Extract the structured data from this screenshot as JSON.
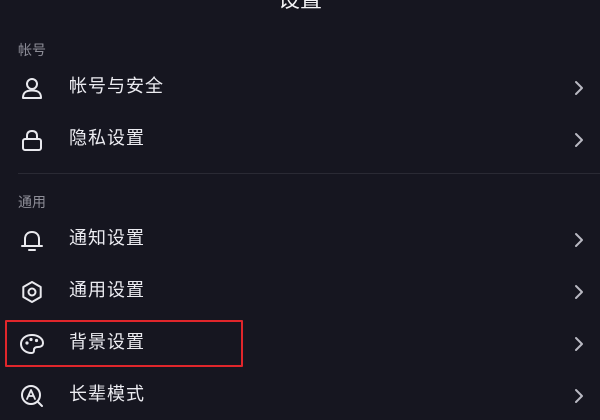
{
  "header": {
    "title": "设置"
  },
  "sections": [
    {
      "label": "帐号",
      "items": [
        {
          "label": "帐号与安全",
          "icon": "person-icon"
        },
        {
          "label": "隐私设置",
          "icon": "lock-icon"
        }
      ]
    },
    {
      "label": "通用",
      "items": [
        {
          "label": "通知设置",
          "icon": "bell-icon"
        },
        {
          "label": "通用设置",
          "icon": "gear-icon"
        },
        {
          "label": "背景设置",
          "icon": "palette-icon"
        },
        {
          "label": "长辈模式",
          "icon": "elder-mode-icon"
        }
      ]
    }
  ],
  "colors": {
    "background": "#161620",
    "highlight": "#e0262b",
    "muted": "#8e8e98"
  }
}
